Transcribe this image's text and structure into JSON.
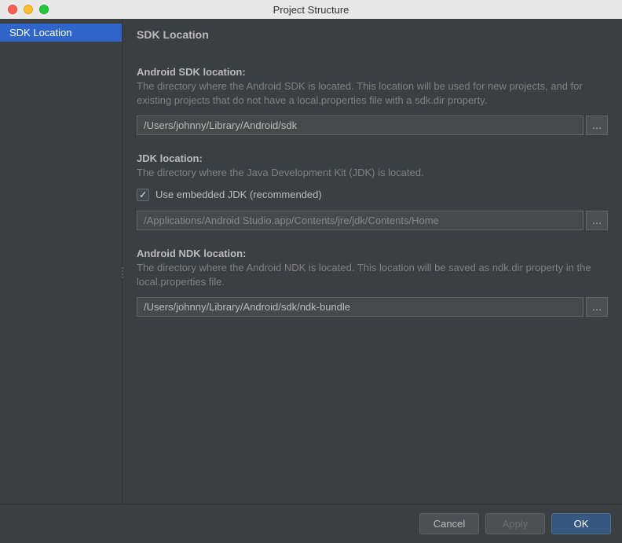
{
  "window": {
    "title": "Project Structure"
  },
  "sidebar": {
    "items": [
      {
        "label": "SDK Location",
        "selected": true
      }
    ]
  },
  "content": {
    "title": "SDK Location",
    "sdk": {
      "label": "Android SDK location:",
      "description": "The directory where the Android SDK is located. This location will be used for new projects, and for existing projects that do not have a local.properties file with a sdk.dir property.",
      "value": "/Users/johnny/Library/Android/sdk",
      "browse_label": "…"
    },
    "jdk": {
      "label": "JDK location:",
      "description": "The directory where the Java Development Kit (JDK) is located.",
      "checkbox_label": "Use embedded JDK (recommended)",
      "checkbox_checked": true,
      "value": "/Applications/Android Studio.app/Contents/jre/jdk/Contents/Home",
      "browse_label": "…"
    },
    "ndk": {
      "label": "Android NDK location:",
      "description": "The directory where the Android NDK is located. This location will be saved as ndk.dir property in the local.properties file.",
      "value": "/Users/johnny/Library/Android/sdk/ndk-bundle",
      "browse_label": "…"
    }
  },
  "footer": {
    "cancel": "Cancel",
    "apply": "Apply",
    "ok": "OK"
  }
}
